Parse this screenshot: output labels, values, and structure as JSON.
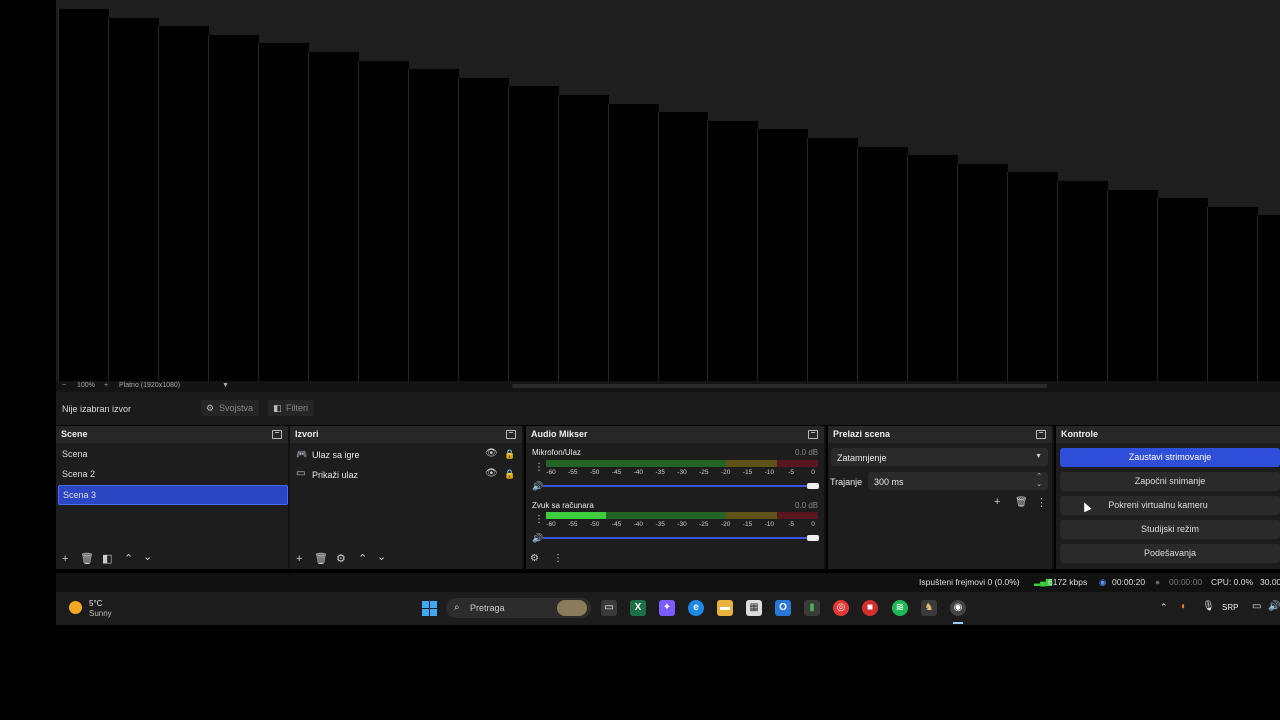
{
  "preview": {
    "zoom": "100%",
    "canvas": "Platno (1920x1080)",
    "zoom_minus": "−",
    "zoom_plus": "+"
  },
  "source_bar": {
    "no_source": "Nije izabran izvor",
    "properties": "Svojstva",
    "filters": "Filteri"
  },
  "scenes": {
    "title": "Scene",
    "items": [
      "Scena",
      "Scena 2",
      "Scena 3"
    ],
    "selected": "Scena 3"
  },
  "sources": {
    "title": "Izvori",
    "items": [
      {
        "label": "Ulaz sa igre",
        "icon": "gamepad-icon"
      },
      {
        "label": "Prikaži ulaz",
        "icon": "monitor-icon"
      }
    ]
  },
  "audio": {
    "title": "Audio Mikser",
    "channels": [
      {
        "name": "Mikrofon/Ulaz",
        "db": "0.0 dB",
        "level": 0
      },
      {
        "name": "Zvuk sa računara",
        "db": "0.0 dB",
        "level": 0.22
      }
    ],
    "ticks": [
      "-60",
      "-55",
      "-50",
      "-45",
      "-40",
      "-35",
      "-30",
      "-25",
      "-20",
      "-15",
      "-10",
      "-5",
      "0"
    ]
  },
  "transitions": {
    "title": "Prelazi scena",
    "selected": "Zatamnjenje",
    "duration_label": "Trajanje",
    "duration_value": "300 ms"
  },
  "controls": {
    "title": "Kontrole",
    "buttons": [
      "Zaustavi strimovanje",
      "Započni snimanje",
      "Pokreni virtualnu kameru",
      "Studijski režim",
      "Podešavanja"
    ],
    "active": "Zaustavi strimovanje"
  },
  "status": {
    "dropped": "Ispušteni frejmovi 0 (0.0%)",
    "bitrate": "6172 kbps",
    "stream_time": "00:00:20",
    "rec_time": "00:00:00",
    "cpu": "CPU: 0.0%",
    "fps": "30.00"
  },
  "taskbar": {
    "temp": "5°C",
    "weather": "Sunny",
    "search": "Pretraga",
    "lang": "SRP"
  },
  "colors": {
    "accent": "#2f4ed9",
    "selected_scene": "#2a46c2",
    "meter_green": "#236323",
    "meter_yellow": "#5e5218",
    "meter_red": "#5a1620"
  }
}
